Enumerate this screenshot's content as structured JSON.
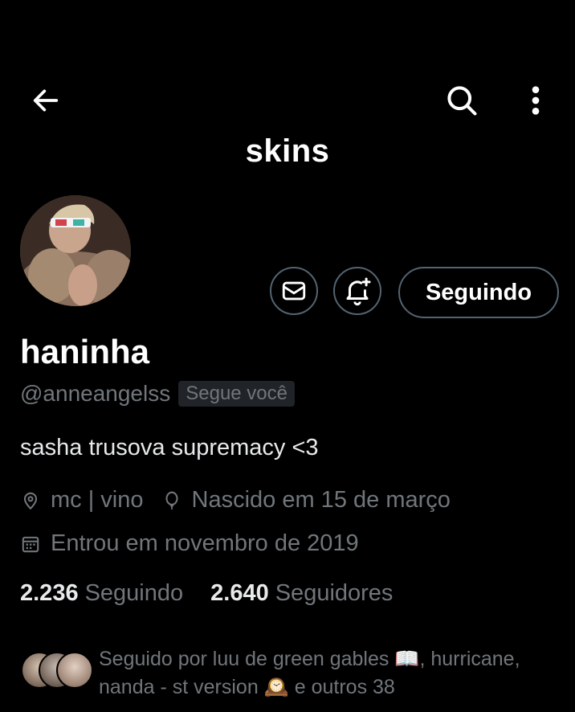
{
  "header": {
    "title": "skins",
    "back_icon": "arrow-left-icon",
    "search_icon": "search-icon",
    "more_icon": "more-vertical-icon"
  },
  "profile": {
    "display_name": "haninha",
    "handle": "@anneangelss",
    "follows_you_badge": "Segue você",
    "bio": "sasha trusova supremacy <3",
    "location": "mc | vino",
    "birthday": "Nascido em 15 de março",
    "joined": "Entrou em novembro de 2019"
  },
  "actions": {
    "message_icon": "envelope-icon",
    "notify_icon": "bell-plus-icon",
    "following_label": "Seguindo"
  },
  "stats": {
    "following_count": "2.236",
    "following_label": "Seguindo",
    "followers_count": "2.640",
    "followers_label": "Seguidores"
  },
  "followers_you_know": {
    "text": "Seguido por luu de green gables 📖, hurricane, nanda - st version 🕰️ e outros 38"
  },
  "colors": {
    "background": "#000000",
    "primary_text": "#e7e9ea",
    "secondary_text": "#71767b",
    "border": "#536471"
  }
}
